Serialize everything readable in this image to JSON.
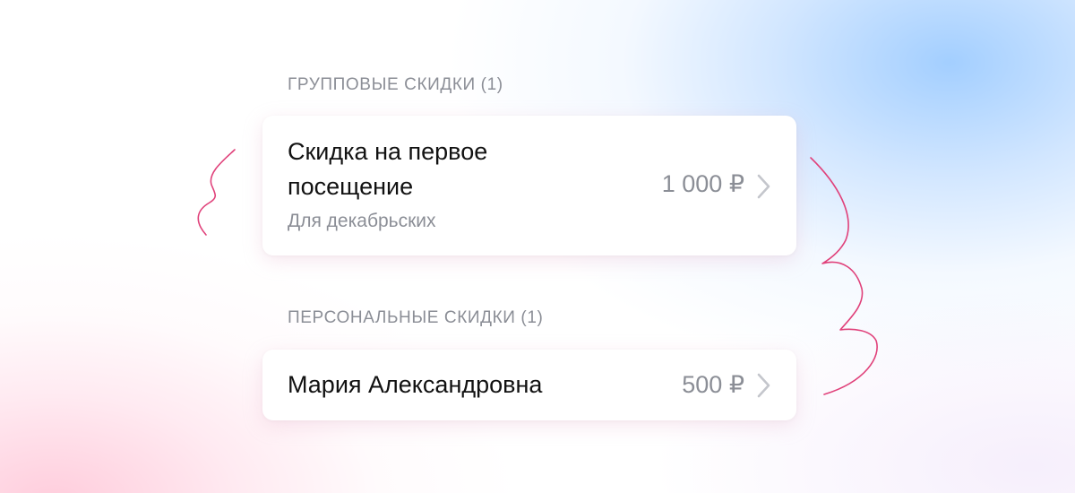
{
  "sections": [
    {
      "header": "ГРУППОВЫЕ СКИДКИ (1)",
      "items": [
        {
          "title": "Скидка на первое посещение",
          "subtitle": "Для декабрьских",
          "amount": "1 000 ₽"
        }
      ]
    },
    {
      "header": "ПЕРСОНАЛЬНЫЕ СКИДКИ (1)",
      "items": [
        {
          "title": "Мария Александровна",
          "amount": "500 ₽"
        }
      ]
    }
  ],
  "colors": {
    "annotation_stroke": "#e0417a",
    "muted_text": "#8b8e96",
    "primary_text": "#111111",
    "chevron": "#c4c6cc"
  },
  "icons": {
    "row_chevron": "chevron-right-icon"
  }
}
